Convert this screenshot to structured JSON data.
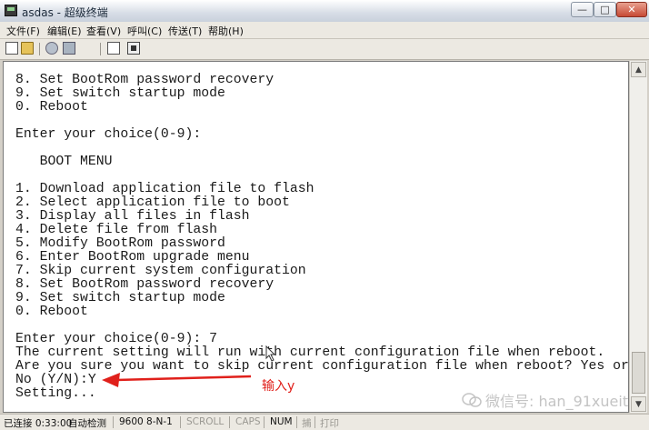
{
  "window": {
    "title": "asdas - 超级终端",
    "buttons": {
      "minimize": "—",
      "maximize": "□",
      "close": "✕"
    }
  },
  "menu": {
    "items": [
      "文件(F)",
      "编辑(E)",
      "查看(V)",
      "呼叫(C)",
      "传送(T)",
      "帮助(H)"
    ]
  },
  "toolbar": {
    "icons": [
      "new-icon",
      "open-icon",
      "connect-icon",
      "disconnect-icon",
      "send-icon",
      "properties-icon"
    ]
  },
  "terminal": {
    "lines": [
      "8. Set BootRom password recovery",
      "9. Set switch startup mode",
      "0. Reboot",
      "",
      "Enter your choice(0-9):",
      "",
      "   BOOT MENU",
      "",
      "1. Download application file to flash",
      "2. Select application file to boot",
      "3. Display all files in flash",
      "4. Delete file from flash",
      "5. Modify BootRom password",
      "6. Enter BootRom upgrade menu",
      "7. Skip current system configuration",
      "8. Set BootRom password recovery",
      "9. Set switch startup mode",
      "0. Reboot",
      "",
      "Enter your choice(0-9): 7",
      "The current setting will run with current configuration file when reboot.",
      "Are you sure you want to skip current configuration file when reboot? Yes or",
      "No (Y/N):Y",
      "Setting..."
    ]
  },
  "annotation": {
    "text": "输入y",
    "color": "#e0201b"
  },
  "watermark": {
    "text": "微信号: han_91xueit"
  },
  "statusbar": {
    "connection": "已连接 0:33:00",
    "detect": "自动检测",
    "settings": "9600 8-N-1",
    "scroll": "SCROLL",
    "caps": "CAPS",
    "num": "NUM",
    "capture": "捕",
    "print": "打印"
  }
}
